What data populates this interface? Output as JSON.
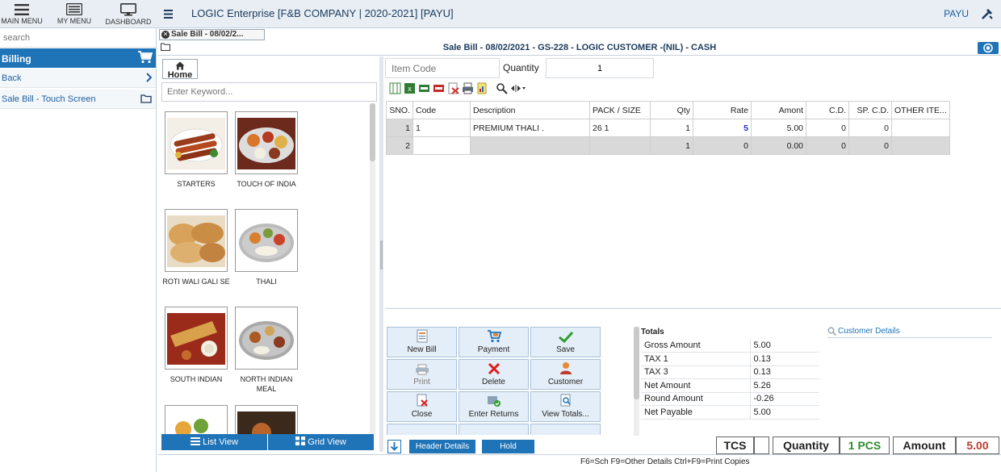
{
  "topbar": {
    "main_menu": "MAIN MENU",
    "my_menu": "MY MENU",
    "dashboard": "DASHBOARD",
    "app_title": "LOGIC Enterprise [F&B COMPANY | 2020-2021] [PAYU]",
    "user": "PAYU"
  },
  "sidebar": {
    "search_placeholder": "search",
    "section_title": "Billing",
    "items": [
      {
        "label": "Back"
      },
      {
        "label": "Sale Bill - Touch Screen"
      }
    ]
  },
  "doc": {
    "tab_label": "Sale Bill - 08/02/2...",
    "header": "Sale Bill - 08/02/2021 - GS-228 - LOGIC CUSTOMER -(NIL) - CASH"
  },
  "categories": {
    "home_label": "Home",
    "keyword_placeholder": "Enter Keyword...",
    "items": [
      {
        "label": "STARTERS"
      },
      {
        "label": "TOUCH OF INDIA"
      },
      {
        "label": "ROTI WALI GALI SE"
      },
      {
        "label": "THALI"
      },
      {
        "label": "SOUTH INDIAN"
      },
      {
        "label": "NORTH INDIAN MEAL"
      }
    ],
    "list_view": "List View",
    "grid_view": "Grid View"
  },
  "entry": {
    "item_code_placeholder": "Item Code",
    "quantity_label": "Quantity",
    "quantity_value": "1"
  },
  "grid": {
    "columns": [
      "SNO.",
      "Code",
      "Description",
      "PACK / SIZE",
      "Qty",
      "Rate",
      "Amont",
      "C.D.",
      "SP. C.D.",
      "OTHER ITE..."
    ],
    "rows": [
      {
        "sno": "1",
        "code": "1",
        "desc": "PREMIUM THALI .",
        "pack": "26 1",
        "qty": "1",
        "rate": "5",
        "amount": "5.00",
        "cd": "0",
        "spcd": "0",
        "other": ""
      },
      {
        "sno": "2",
        "code": "",
        "desc": "",
        "pack": "",
        "qty": "1",
        "rate": "0",
        "amount": "0.00",
        "cd": "0",
        "spcd": "0",
        "other": ""
      }
    ]
  },
  "actions": {
    "new_bill": "New Bill",
    "payment": "Payment",
    "save": "Save",
    "print": "Print",
    "delete": "Delete",
    "customer": "Customer",
    "close": "Close",
    "enter_returns": "Enter Returns",
    "view_totals": "View Totals..."
  },
  "totals": {
    "title": "Totals",
    "rows": [
      {
        "k": "Gross Amount",
        "v": "5.00"
      },
      {
        "k": "TAX 1",
        "v": "0.13"
      },
      {
        "k": "TAX 3",
        "v": "0.13"
      },
      {
        "k": "Net Amount",
        "v": "5.26"
      },
      {
        "k": "Round Amount",
        "v": "-0.26"
      },
      {
        "k": "Net Payable",
        "v": "5.00"
      }
    ]
  },
  "customer_details": "Customer Details",
  "bottom": {
    "header_details": "Header Details",
    "hold": "Hold",
    "tcs": "TCS",
    "quantity_label": "Quantity",
    "quantity_value": "1 PCS",
    "amount_label": "Amount",
    "amount_value": "5.00",
    "hint": "F6=Sch F9=Other Details Ctrl+F9=Print Copies"
  },
  "colors": {
    "accent": "#1f73b7",
    "qty_green": "#2e8b2e",
    "amount_red": "#c0392b"
  }
}
